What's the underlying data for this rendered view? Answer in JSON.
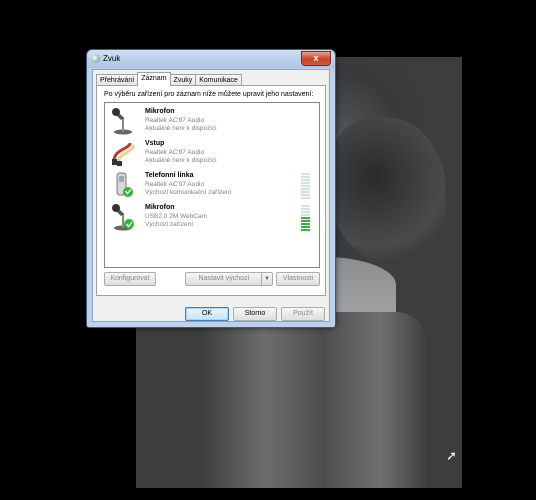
{
  "window": {
    "title": "Zvuk",
    "close_label": "x"
  },
  "tabs": [
    {
      "label": "Přehrávání"
    },
    {
      "label": "Záznam",
      "active": true
    },
    {
      "label": "Zvuky"
    },
    {
      "label": "Komunikace"
    }
  ],
  "instruction": "Po výběru zařízení pro záznam níže můžete upravit jeho nastavení:",
  "devices": [
    {
      "name": "Mikrofon",
      "driver": "Realtek AC'97 Audio",
      "status": "Aktuálně není k dispozici",
      "icon": "microphone-icon",
      "badge": "none",
      "level": 0
    },
    {
      "name": "Vstup",
      "driver": "Realtek AC'97 Audio",
      "status": "Aktuálně není k dispozici",
      "icon": "line-in-cable-icon",
      "badge": "none",
      "level": 0
    },
    {
      "name": "Telefonní linka",
      "driver": "Realtek AC'97 Audio",
      "status": "Výchozí komunikační zařízení",
      "icon": "phone-icon",
      "badge": "phone",
      "level": 0
    },
    {
      "name": "Mikrofon",
      "driver": "USB2.0 2M WebCam",
      "status": "Výchozí zařízení",
      "icon": "microphone-icon",
      "badge": "check",
      "level": 0.6
    }
  ],
  "buttons": {
    "configure": "Konfigurovat",
    "set_default": "Nastavit výchozí",
    "properties": "Vlastnosti",
    "ok": "OK",
    "cancel": "Storno",
    "apply": "Použít"
  },
  "colors": {
    "level_on": "#3caf3c",
    "level_off": "#cfe2e5",
    "check_badge": "#2db82d"
  }
}
